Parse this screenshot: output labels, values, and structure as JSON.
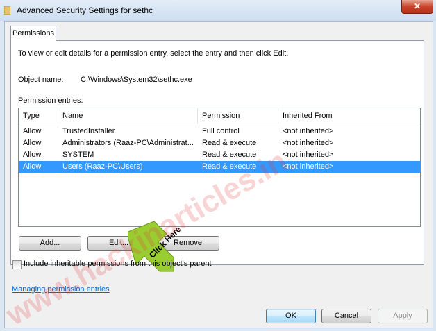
{
  "window": {
    "title": "Advanced Security Settings for sethc",
    "close_glyph": "✕"
  },
  "tabs": [
    {
      "label": "Permissions"
    }
  ],
  "panel": {
    "intro": "To view or edit details for a permission entry, select the entry and then click Edit.",
    "object_name_label": "Object name:",
    "object_name_value": "C:\\Windows\\System32\\sethc.exe",
    "entries_label": "Permission entries:"
  },
  "table": {
    "columns": [
      "Type",
      "Name",
      "Permission",
      "Inherited From"
    ],
    "rows": [
      {
        "type": "Allow",
        "name": "TrustedInstaller",
        "permission": "Full control",
        "inherited": "<not inherited>",
        "selected": false
      },
      {
        "type": "Allow",
        "name": "Administrators (Raaz-PC\\Administrat...",
        "permission": "Read & execute",
        "inherited": "<not inherited>",
        "selected": false
      },
      {
        "type": "Allow",
        "name": "SYSTEM",
        "permission": "Read & execute",
        "inherited": "<not inherited>",
        "selected": false
      },
      {
        "type": "Allow",
        "name": "Users (Raaz-PC\\Users)",
        "permission": "Read & execute",
        "inherited": "<not inherited>",
        "selected": true
      }
    ]
  },
  "buttons": {
    "add": "Add...",
    "edit": "Edit...",
    "remove": "Remove",
    "ok": "OK",
    "cancel": "Cancel",
    "apply": "Apply"
  },
  "checkbox": {
    "label": "Include inheritable permissions from this object's parent",
    "checked": false
  },
  "link": {
    "label": "Managing permission entries"
  },
  "annotation": {
    "arrow_label": "Click Here",
    "arrow_color": "#9acd32"
  },
  "watermark": {
    "text": "www.hackinarticles.in",
    "color": "#e23b3b"
  },
  "colors": {
    "selection": "#3399ff",
    "link": "#0066cc"
  }
}
